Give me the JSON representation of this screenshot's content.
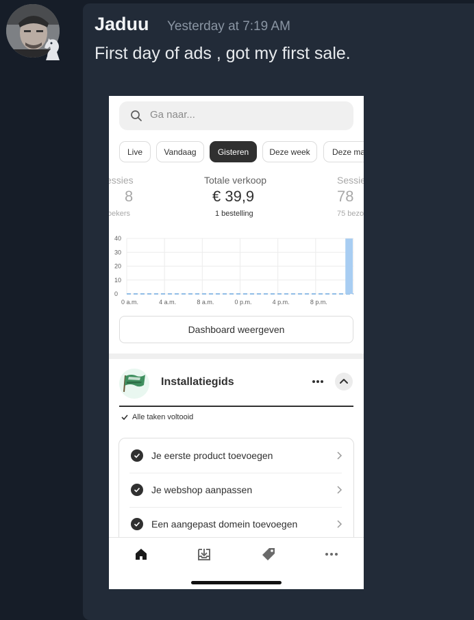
{
  "message": {
    "username": "Jaduu",
    "timestamp": "Yesterday at 7:19 AM",
    "text": "First day of ads , got my first sale."
  },
  "avatar_icon": "user-avatar",
  "badge_icon": "chess-knight-icon",
  "app": {
    "search": {
      "placeholder": "Ga naar...",
      "icon": "search-icon"
    },
    "filters": [
      {
        "label": "Live",
        "active": false
      },
      {
        "label": "Vandaag",
        "active": false
      },
      {
        "label": "Gisteren",
        "active": true
      },
      {
        "label": "Deze week",
        "active": false
      },
      {
        "label": "Deze ma",
        "active": false
      }
    ],
    "metrics": {
      "left": {
        "label": "essies",
        "value": "8",
        "sub": "oekers"
      },
      "center": {
        "label": "Totale verkoop",
        "value": "€ 39,9",
        "sub": "1 bestelling"
      },
      "right": {
        "label": "Sessie",
        "value": "78",
        "sub": "75 bezo"
      }
    },
    "dashboard_button": "Dashboard weergeven",
    "setup_guide": {
      "title": "Installatiegids",
      "status": "Alle taken voltooid",
      "more_icon": "more-dots-icon",
      "collapse_icon": "chevron-up-icon",
      "tasks": [
        {
          "label": "Je eerste product toevoegen",
          "done": true
        },
        {
          "label": "Je webshop aanpassen",
          "done": true
        },
        {
          "label": "Een aangepast domein toevoegen",
          "done": true
        }
      ]
    },
    "bottom_nav": [
      {
        "icon": "home-icon",
        "active": true
      },
      {
        "icon": "orders-inbox-icon",
        "active": false
      },
      {
        "icon": "tag-icon",
        "active": false
      },
      {
        "icon": "more-dots-icon",
        "active": false
      }
    ]
  },
  "chart_data": {
    "type": "bar",
    "title": "",
    "xlabel": "",
    "ylabel": "",
    "ylim": [
      0,
      40
    ],
    "yticks": [
      "0",
      "10",
      "20",
      "30",
      "40"
    ],
    "xtick_labels": [
      "0 a.m.",
      "4 a.m.",
      "8 a.m.",
      "0 p.m.",
      "4 p.m.",
      "8 p.m."
    ],
    "hours": [
      0,
      1,
      2,
      3,
      4,
      5,
      6,
      7,
      8,
      9,
      10,
      11,
      12,
      13,
      14,
      15,
      16,
      17,
      18,
      19,
      20,
      21,
      22,
      23
    ],
    "values": [
      0,
      0,
      0,
      0,
      0,
      0,
      0,
      0,
      0,
      0,
      0,
      0,
      0,
      0,
      0,
      0,
      0,
      0,
      0,
      0,
      0,
      0,
      0,
      39.9
    ],
    "comparison_series": {
      "values": [
        0,
        0,
        0,
        0,
        0,
        0,
        0,
        0,
        0,
        0,
        0,
        0,
        0,
        0,
        0,
        0,
        0,
        0,
        0,
        0,
        0,
        0,
        0,
        0
      ],
      "style": "dashed"
    },
    "colors": {
      "bar": "#a8cdf2",
      "dashed": "#8fbce6",
      "grid": "#ececec"
    },
    "grid": true
  }
}
